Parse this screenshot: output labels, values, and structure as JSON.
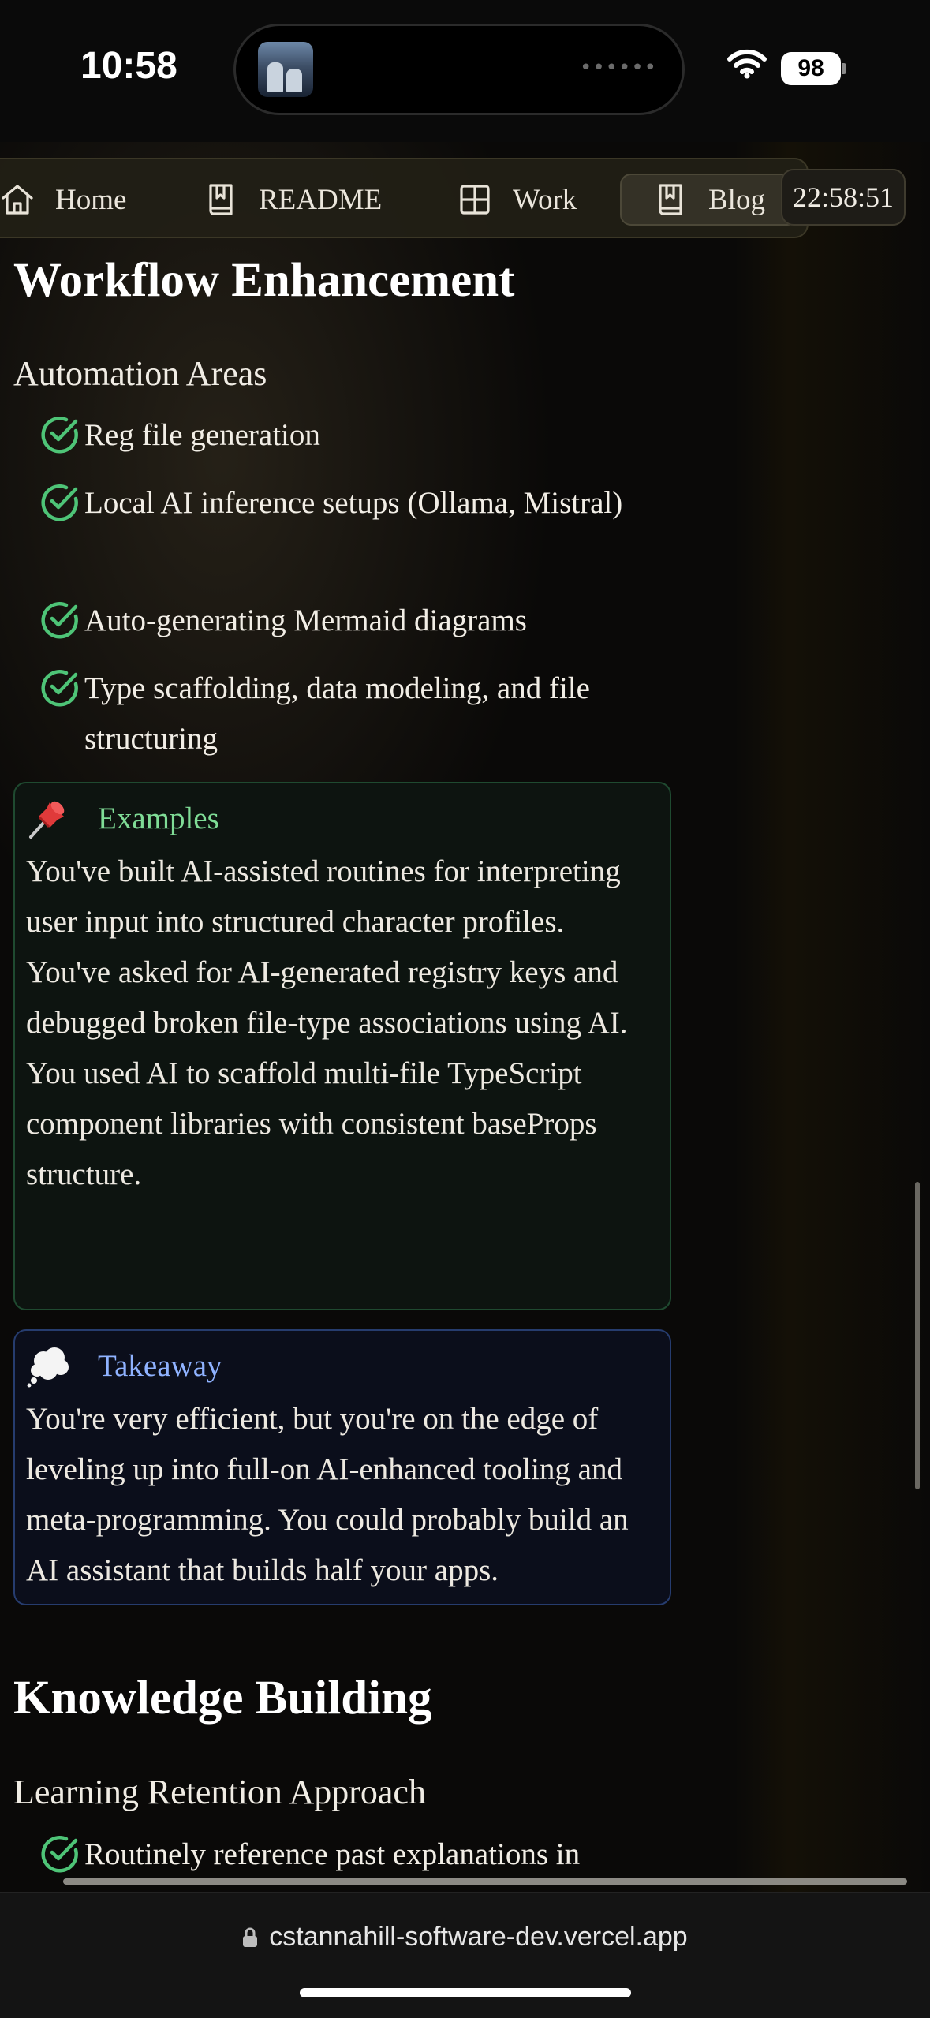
{
  "status_bar": {
    "time": "10:58",
    "battery": "98",
    "island_dots": "••••••"
  },
  "nav": {
    "items": [
      {
        "label": "Home",
        "icon": "home-icon"
      },
      {
        "label": "README",
        "icon": "book-icon"
      },
      {
        "label": "Work",
        "icon": "grid-icon"
      },
      {
        "label": "Blog",
        "icon": "book-icon",
        "active": true
      }
    ],
    "clock": "22:58:51"
  },
  "workflow": {
    "heading": "Workflow Enhancement",
    "subheading": "Automation Areas",
    "items": [
      "Reg file generation",
      "Local AI inference setups (Ollama, Mistral)",
      "Auto-generating Mermaid diagrams",
      "Type scaffolding, data modeling, and file structuring"
    ],
    "examples": {
      "icon": "pushpin-icon",
      "label": "Examples",
      "paragraphs": [
        "You've built AI-assisted routines for interpreting user input into structured character profiles.",
        "You've asked for AI-generated registry keys and debugged broken file-type associations using AI.",
        "You used AI to scaffold multi-file TypeScript component libraries with consistent baseProps structure."
      ]
    },
    "takeaway": {
      "icon": "thought-bubble-icon",
      "label": "Takeaway",
      "text": "You're very efficient, but you're on the edge of leveling up into full-on AI-enhanced tooling and meta-programming. You could probably build an AI assistant that builds half your apps."
    }
  },
  "knowledge": {
    "heading": "Knowledge Building",
    "subheading": "Learning Retention Approach",
    "items": [
      "Routinely reference past explanations in"
    ]
  },
  "browser": {
    "url": "cstannahill-software-dev.vercel.app"
  },
  "colors": {
    "check": "#4ec477",
    "examples_accent": "#7fdc96",
    "takeaway_accent": "#8fb2ff"
  }
}
